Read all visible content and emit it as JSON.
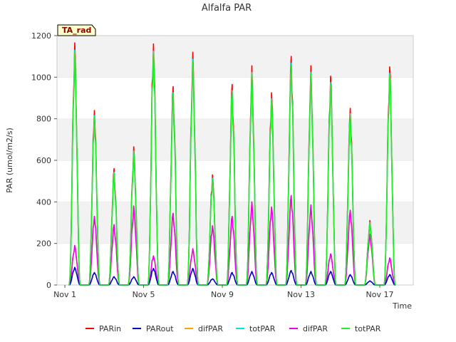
{
  "chart_data": {
    "type": "line",
    "title": "Alfalfa PAR",
    "xlabel": "Time",
    "ylabel": "PAR (umol/m2/s)",
    "badge": "TA_rad",
    "ylim": [
      0,
      1200
    ],
    "yticks": [
      0,
      200,
      400,
      600,
      800,
      1000,
      1200
    ],
    "xlim": [
      0.6,
      18.7
    ],
    "xticks": [
      {
        "day": 1,
        "label": "Nov 1"
      },
      {
        "day": 5,
        "label": "Nov 5"
      },
      {
        "day": 9,
        "label": "Nov 9"
      },
      {
        "day": 13,
        "label": "Nov 13"
      },
      {
        "day": 17,
        "label": "Nov 17"
      }
    ],
    "grid": "horizontal bands",
    "legend_position": "bottom",
    "daily_peaks": [
      {
        "day": 1,
        "parin": 1165,
        "parout": 85,
        "dif": 190
      },
      {
        "day": 2,
        "parin": 840,
        "parout": 60,
        "dif": 330
      },
      {
        "day": 3,
        "parin": 560,
        "parout": 40,
        "dif": 290
      },
      {
        "day": 4,
        "parin": 665,
        "parout": 40,
        "dif": 380
      },
      {
        "day": 5,
        "parin": 1160,
        "parout": 80,
        "dif": 140
      },
      {
        "day": 6,
        "parin": 955,
        "parout": 65,
        "dif": 345
      },
      {
        "day": 7,
        "parin": 1120,
        "parout": 80,
        "dif": 175
      },
      {
        "day": 8,
        "parin": 530,
        "parout": 30,
        "dif": 285
      },
      {
        "day": 9,
        "parin": 965,
        "parout": 60,
        "dif": 330
      },
      {
        "day": 10,
        "parin": 1055,
        "parout": 65,
        "dif": 400
      },
      {
        "day": 11,
        "parin": 925,
        "parout": 60,
        "dif": 375
      },
      {
        "day": 12,
        "parin": 1100,
        "parout": 70,
        "dif": 430
      },
      {
        "day": 13,
        "parin": 1055,
        "parout": 65,
        "dif": 385
      },
      {
        "day": 14,
        "parin": 1005,
        "parout": 65,
        "dif": 150
      },
      {
        "day": 15,
        "parin": 850,
        "parout": 50,
        "dif": 360
      },
      {
        "day": 16,
        "parin": 310,
        "parout": 20,
        "dif": 245
      },
      {
        "day": 17,
        "parin": 1050,
        "parout": 50,
        "dif": 130
      }
    ],
    "series": [
      {
        "name": "PARin",
        "color": "#ff0000"
      },
      {
        "name": "PARout",
        "color": "#0000cc"
      },
      {
        "name": "difPAR",
        "color": "#ffa500"
      },
      {
        "name": "totPAR",
        "color": "#00e5e5"
      },
      {
        "name": "difPAR",
        "color": "#ee00ee"
      },
      {
        "name": "totPAR",
        "color": "#22ee22"
      }
    ]
  }
}
